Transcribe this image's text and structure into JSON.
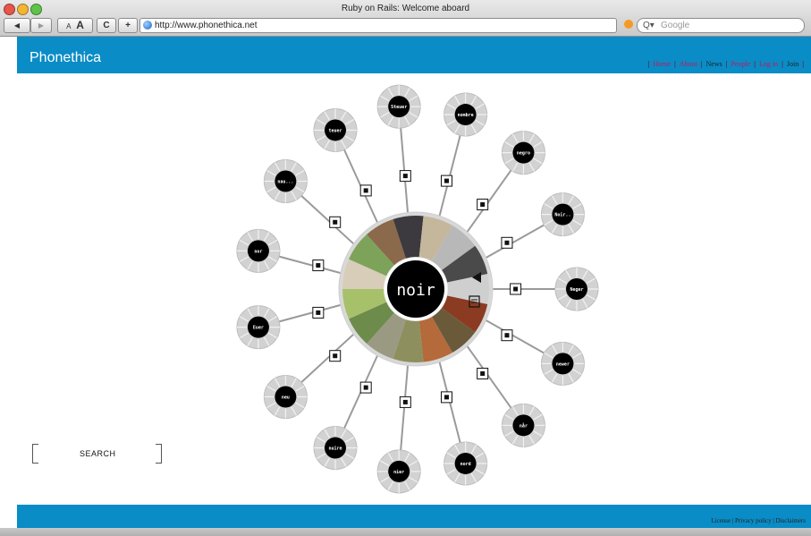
{
  "window": {
    "title": "Ruby on Rails: Welcome aboard",
    "url": "http://www.phonethica.net",
    "search_placeholder": "Google",
    "text_small_a": "A",
    "text_large_a": "A",
    "reload_glyph": "C",
    "add_glyph": "+",
    "back_glyph": "◀",
    "forward_glyph": "▶",
    "search_prefix": "Q▾"
  },
  "site": {
    "brand": "Phonethica",
    "nav": [
      "Home",
      "About",
      "News",
      "People",
      "Log in",
      "Join"
    ],
    "nav_colors": [
      "#c2185b",
      "#c2185b",
      "#222222",
      "#c2185b",
      "#c2185b",
      "#222222"
    ],
    "search_label": "SEARCH",
    "footer_links": "License | Privacy policy | Disclaimers"
  },
  "wheel": {
    "center": "noir",
    "nodes": [
      "Neger",
      "newer",
      "når",
      "nord",
      "nier",
      "nuire",
      "neu",
      "Euer",
      "nor",
      "nau...",
      "teuer",
      "Steuer",
      "nombre",
      "negro",
      "Noir.."
    ]
  },
  "colors": {
    "header_blue": "#0a8cc6",
    "accent_magenta": "#c2185b"
  }
}
